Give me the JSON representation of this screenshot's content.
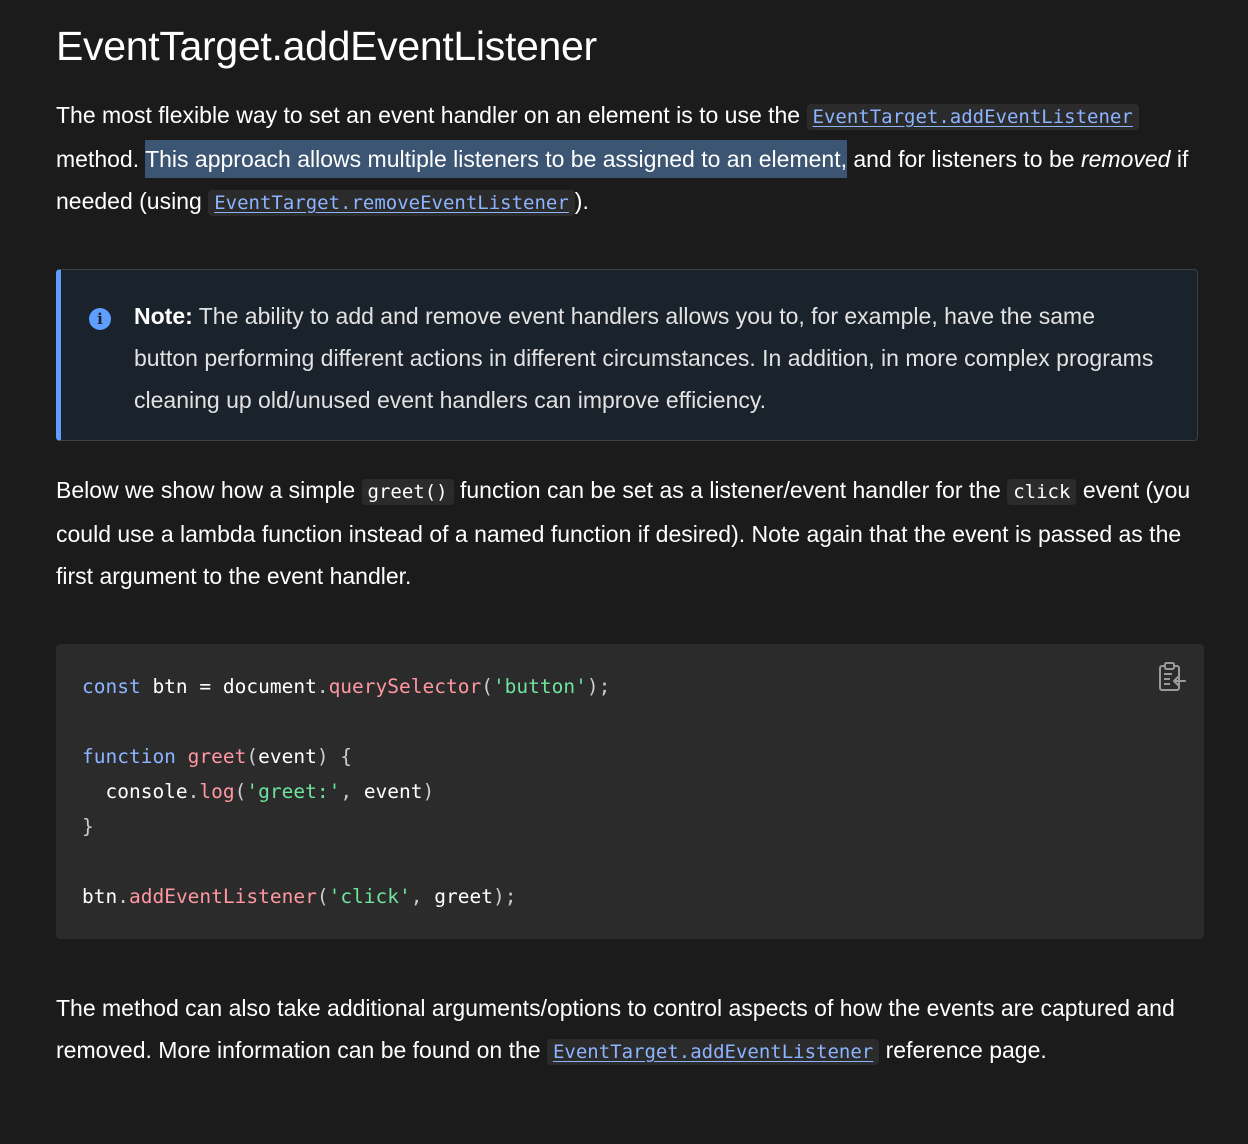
{
  "heading": "EventTarget.addEventListener",
  "para1": {
    "text_1": "The most flexible way to set an event handler on an element is to use the ",
    "link_1": "EventTarget.addEventListener",
    "text_2": " method. ",
    "highlight": "This approach allows multiple listeners to be assigned to an element,",
    "text_3": " and for listeners to be ",
    "emphasis": "removed",
    "text_4": " if needed (using ",
    "link_2": "EventTarget.removeEventListener",
    "text_5": ")."
  },
  "note": {
    "icon": "info-icon",
    "label": "Note:",
    "text": " The ability to add and remove event handlers allows you to, for example, have the same button performing different actions in different circumstances. In addition, in more complex programs cleaning up old/unused event handlers can improve efficiency."
  },
  "para2": {
    "text_1": "Below we show how a simple ",
    "code_1": "greet()",
    "text_2": " function can be set as a listener/event handler for the ",
    "code_2": "click",
    "text_3": " event (you could use a lambda function instead of a named function if desired). Note again that the event is passed as the first argument to the event handler."
  },
  "code": {
    "l1_kw": "const",
    "l1_a": " btn = document",
    "l1_dot": ".",
    "l1_fn": "querySelector",
    "l1_p1": "(",
    "l1_str": "'button'",
    "l1_p2": ");",
    "l3_kw": "function",
    "l3_sp": " ",
    "l3_fn": "greet",
    "l3_p1": "(",
    "l3_arg": "event",
    "l3_p2": ") {",
    "l4_a": "  console",
    "l4_dot": ".",
    "l4_fn": "log",
    "l4_p1": "(",
    "l4_str": "'greet:'",
    "l4_p2": ", ",
    "l4_arg": "event",
    "l4_p3": ")",
    "l5": "}",
    "l7_a": "btn",
    "l7_dot": ".",
    "l7_fn": "addEventListener",
    "l7_p1": "(",
    "l7_str": "'click'",
    "l7_p2": ", ",
    "l7_arg": "greet",
    "l7_p3": ");",
    "copy_icon": "clipboard-icon"
  },
  "para3": {
    "text_1": "The method can also take additional arguments/options to control aspects of how the events are captured and removed. More information can be found on the ",
    "link_1": "EventTarget.addEventListener",
    "text_2": " reference page."
  },
  "colors": {
    "background": "#1b1b1b",
    "link": "#8cb4ff",
    "note_accent": "#5e9eff",
    "selection": "#3c5572",
    "code_keyword": "#8cb4ff",
    "code_function": "#ff97a0",
    "code_string": "#6ee39d"
  }
}
